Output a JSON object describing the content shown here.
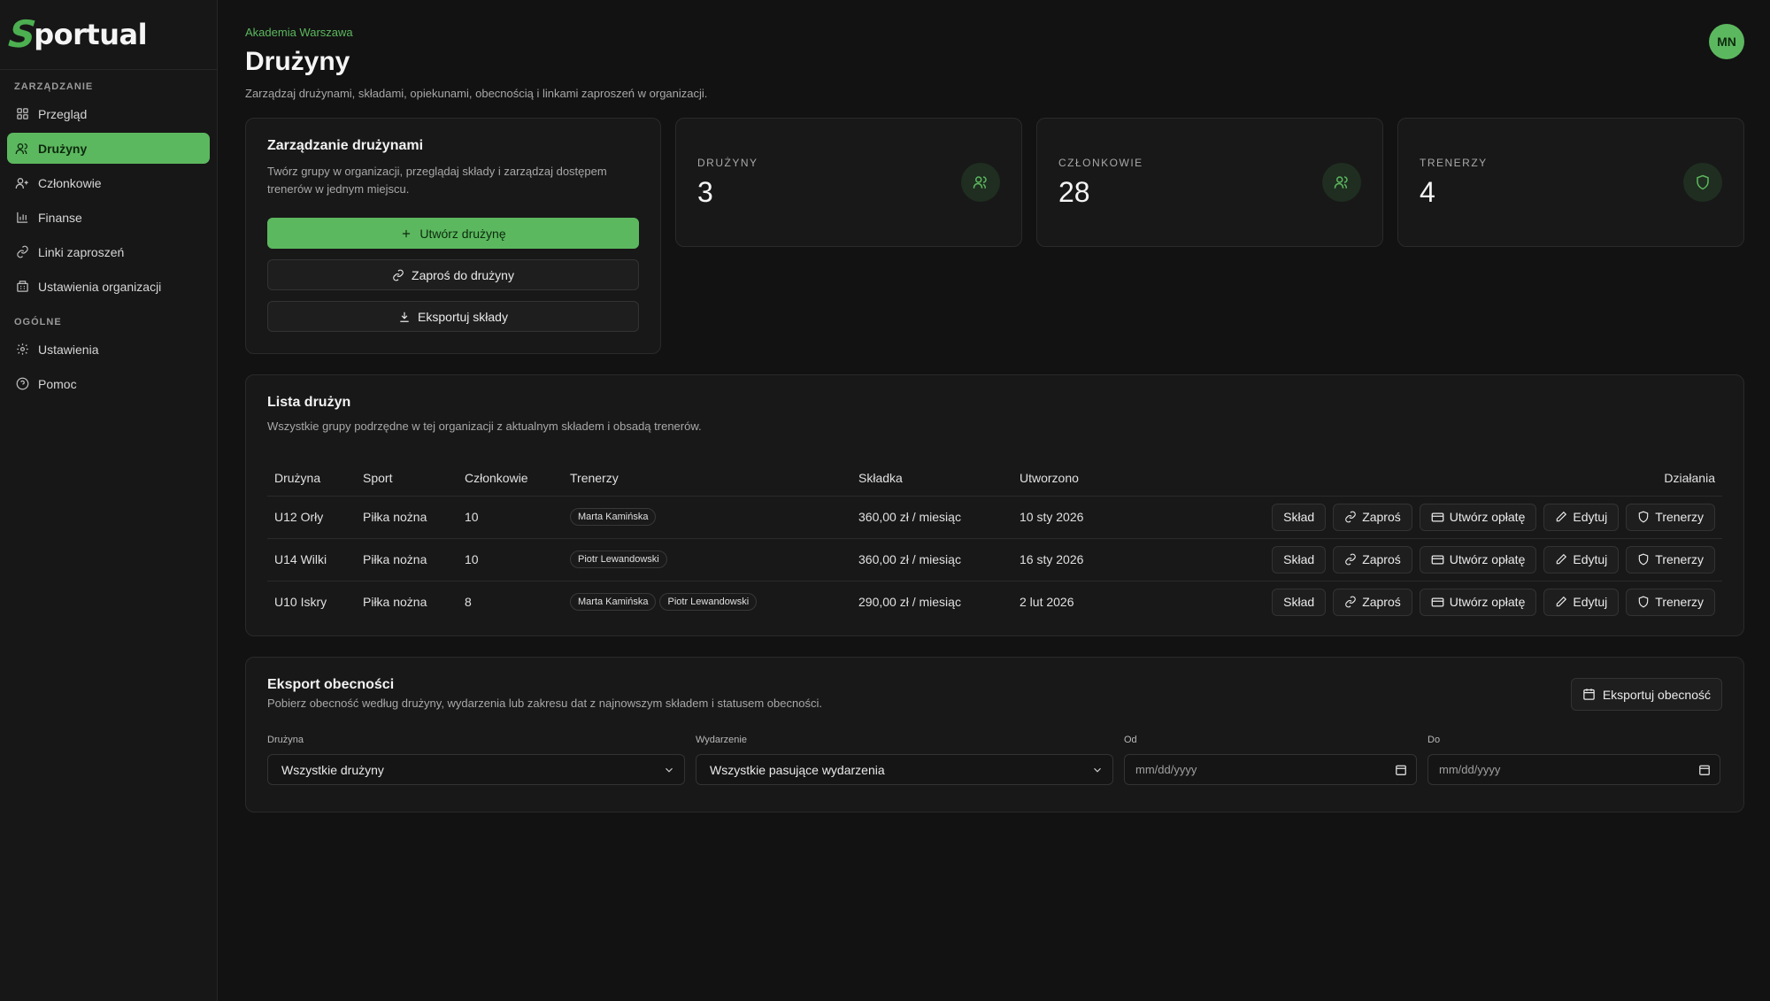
{
  "brand": {
    "logo_letter": "S",
    "logo_rest": "portual"
  },
  "sidebar": {
    "section_manage": "ZARZĄDZANIE",
    "section_general": "OGÓLNE",
    "items": [
      {
        "label": "Przegląd",
        "icon": "grid-icon"
      },
      {
        "label": "Drużyny",
        "icon": "users-icon",
        "active": true
      },
      {
        "label": "Członkowie",
        "icon": "user-plus-icon"
      },
      {
        "label": "Finanse",
        "icon": "bar-chart-icon"
      },
      {
        "label": "Linki zaproszeń",
        "icon": "link-icon"
      },
      {
        "label": "Ustawienia organizacji",
        "icon": "building-icon"
      }
    ],
    "general_items": [
      {
        "label": "Ustawienia",
        "icon": "gear-icon"
      },
      {
        "label": "Pomoc",
        "icon": "help-circle-icon"
      }
    ]
  },
  "header": {
    "org_name": "Akademia Warszawa",
    "title": "Drużyny",
    "subtitle": "Zarządzaj drużynami, składami, opiekunami, obecnością i linkami zaproszeń w organizacji.",
    "avatar_initials": "MN"
  },
  "manage": {
    "title": "Zarządzanie drużynami",
    "desc": "Twórz grupy w organizacji, przeglądaj składy i zarządzaj dostępem trenerów w jednym miejscu.",
    "create_label": "Utwórz drużynę",
    "invite_label": "Zaproś do drużyny",
    "export_label": "Eksportuj składy"
  },
  "stats": [
    {
      "label": "DRUŻYNY",
      "value": "3"
    },
    {
      "label": "CZŁONKOWIE",
      "value": "28"
    },
    {
      "label": "TRENERZY",
      "value": "4"
    }
  ],
  "teams": {
    "title": "Lista drużyn",
    "desc": "Wszystkie grupy podrzędne w tej organizacji z aktualnym składem i obsadą trenerów.",
    "columns": [
      "Drużyna",
      "Sport",
      "Członkowie",
      "Trenerzy",
      "Składka",
      "Utworzono",
      "Działania"
    ],
    "actions": [
      "Skład",
      "Zaproś",
      "Utwórz opłatę",
      "Edytuj",
      "Trenerzy"
    ],
    "rows": [
      {
        "name": "U12 Orły",
        "sport": "Piłka nożna",
        "members": "10",
        "coaches": [
          "Marta Kamińska"
        ],
        "fee": "360,00 zł / miesiąc",
        "created": "10 sty 2026"
      },
      {
        "name": "U14 Wilki",
        "sport": "Piłka nożna",
        "members": "10",
        "coaches": [
          "Piotr Lewandowski"
        ],
        "fee": "360,00 zł / miesiąc",
        "created": "16 sty 2026"
      },
      {
        "name": "U10 Iskry",
        "sport": "Piłka nożna",
        "members": "8",
        "coaches": [
          "Marta Kamińska",
          "Piotr Lewandowski"
        ],
        "fee": "290,00 zł / miesiąc",
        "created": "2 lut 2026"
      }
    ]
  },
  "export": {
    "title": "Eksport obecności",
    "desc": "Pobierz obecność według drużyny, wydarzenia lub zakresu dat z najnowszym składem i statusem obecności.",
    "button_label": "Eksportuj obecność",
    "team_label": "Drużyna",
    "team_value": "Wszystkie drużyny",
    "event_label": "Wydarzenie",
    "event_value": "Wszystkie pasujące wydarzenia",
    "from_label": "Od",
    "from_placeholder": "mm/dd/yyyy",
    "to_label": "Do",
    "to_placeholder": "mm/dd/yyyy"
  },
  "colors": {
    "accent": "#5cb85f",
    "background": "#121212",
    "card": "#181818"
  }
}
